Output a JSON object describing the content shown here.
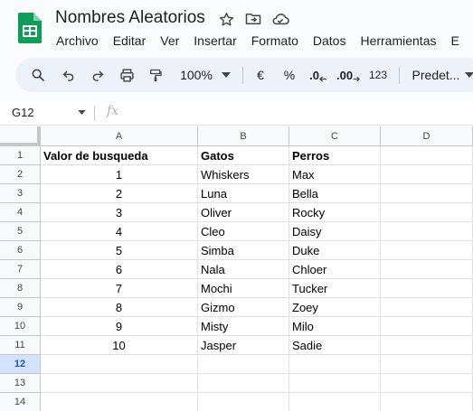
{
  "app": {
    "title": "Nombres Aleatorios",
    "brand_color": "#0f9d58"
  },
  "title_icons": [
    "star-icon",
    "move-to-folder-icon",
    "cloud-saved-icon"
  ],
  "menu": [
    "Archivo",
    "Editar",
    "Ver",
    "Insertar",
    "Formato",
    "Datos",
    "Herramientas",
    "E"
  ],
  "toolbar": {
    "zoom": "100%",
    "currency": "€",
    "percent": "%",
    "decrease_decimals": ".0",
    "increase_decimals": ".00",
    "number_format": "123",
    "font": "Predet..."
  },
  "formula_bar": {
    "cell_ref": "G12",
    "fx": "fx",
    "value": ""
  },
  "grid": {
    "columns": [
      "A",
      "B",
      "C",
      "D"
    ],
    "rows": [
      "1",
      "2",
      "3",
      "4",
      "5",
      "6",
      "7",
      "8",
      "9",
      "10",
      "11",
      "12",
      "13",
      "14"
    ],
    "selected_row": "12",
    "header_row": [
      "Valor de busqueda",
      "Gatos",
      "Perros",
      ""
    ],
    "data": [
      [
        "1",
        "Whiskers",
        "Max"
      ],
      [
        "2",
        "Luna",
        "Bella"
      ],
      [
        "3",
        "Oliver",
        "Rocky"
      ],
      [
        "4",
        "Cleo",
        "Daisy"
      ],
      [
        "5",
        "Simba",
        "Duke"
      ],
      [
        "6",
        "Nala",
        "Chloer"
      ],
      [
        "7",
        "Mochi",
        "Tucker"
      ],
      [
        "8",
        "Gizmo",
        "Zoey"
      ],
      [
        "9",
        "Misty",
        "Milo"
      ],
      [
        "10",
        "Jasper",
        "Sadie"
      ]
    ]
  }
}
